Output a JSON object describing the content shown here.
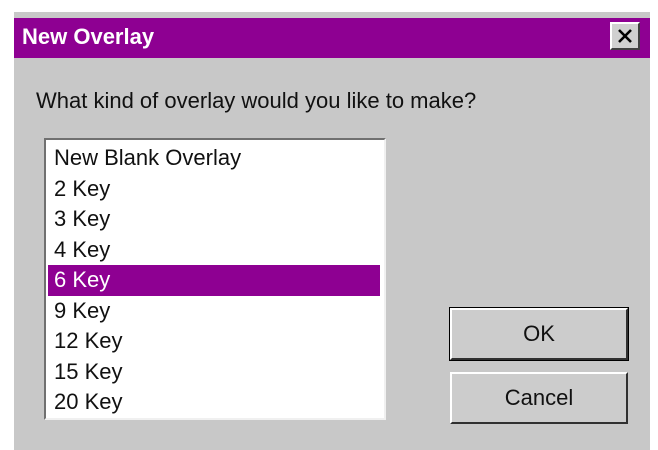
{
  "window": {
    "title": "New Overlay",
    "close_icon": "close-icon",
    "accent_color": "#8e0092"
  },
  "prompt": "What kind of overlay would you like to make?",
  "overlay_list": {
    "items": [
      "New Blank Overlay",
      "2 Key",
      "3 Key",
      "4 Key",
      "6 Key",
      "9 Key",
      "12 Key",
      "15 Key",
      "20 Key"
    ],
    "selected": "6 Key"
  },
  "buttons": {
    "ok_label": "OK",
    "cancel_label": "Cancel"
  }
}
